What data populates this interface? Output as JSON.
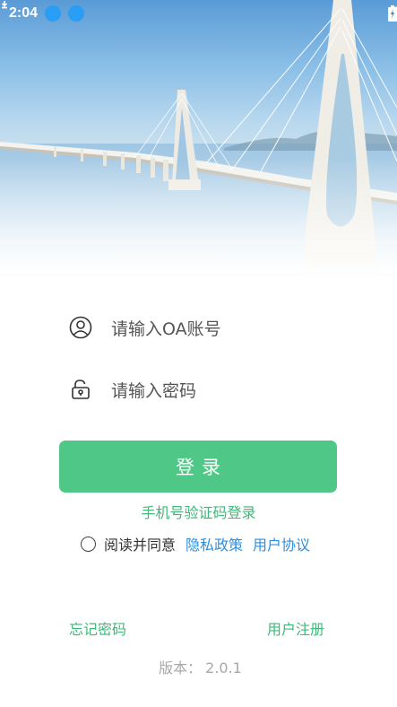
{
  "status_bar": {
    "time": "2:04",
    "icons": [
      "download-icon",
      "download-icon",
      "wifi-icon",
      "signal-icon",
      "battery-icon"
    ]
  },
  "hero": {
    "image": "cable-stayed-bridge-over-sea"
  },
  "form": {
    "account_placeholder": "请输入OA账号",
    "password_placeholder": "请输入密码",
    "login_label": "登录"
  },
  "links": {
    "sms_login": "手机号验证码登录",
    "agree_text": "阅读并同意",
    "privacy_policy": "隐私政策",
    "user_agreement": "用户协议",
    "forgot_password": "忘记密码",
    "register": "用户注册"
  },
  "version": {
    "label": "版本：",
    "value": "2.0.1"
  },
  "colors": {
    "accent_green": "#4fc786",
    "link_green": "#3fb87a",
    "link_blue": "#2b8fe0",
    "download_blue": "#2a9df4"
  }
}
